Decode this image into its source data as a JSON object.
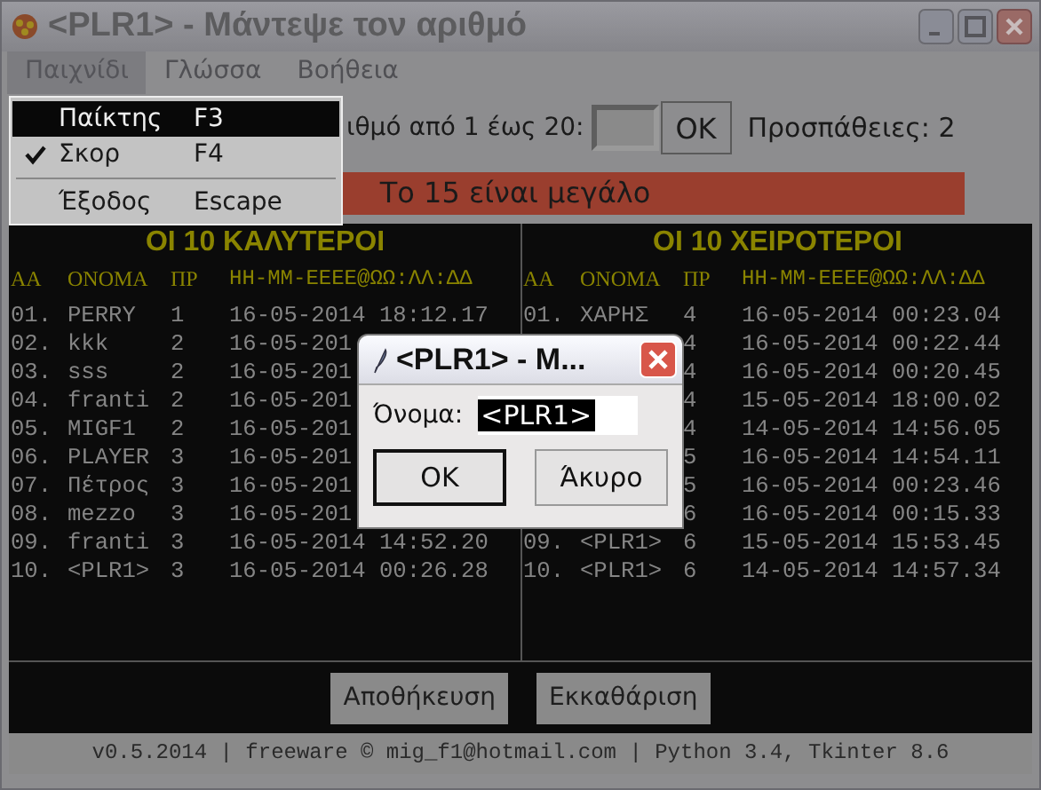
{
  "window": {
    "title": "<PLR1> - Μάντεψε τον αριθμό"
  },
  "menu_bar": [
    {
      "label": "Παιχνίδι",
      "selected": true
    },
    {
      "label": "Γλώσσα",
      "selected": false
    },
    {
      "label": "Βοήθεια",
      "selected": false
    }
  ],
  "menu_dropdown": [
    {
      "kind": "item",
      "label": "Παίκτης",
      "shortcut": "F3",
      "selected": true,
      "checked": false
    },
    {
      "kind": "item",
      "label": "Σκορ",
      "shortcut": "F4",
      "selected": false,
      "checked": true
    },
    {
      "kind": "separator"
    },
    {
      "kind": "item",
      "label": "Έξοδος",
      "shortcut": "Escape",
      "selected": false,
      "checked": false
    }
  ],
  "guess": {
    "prompt": "ιθμό από 1 έως 20:",
    "ok_button": "OK",
    "attempts": "Προσπάθειες: 2"
  },
  "message": "Το 15 είναι μεγάλο",
  "scoreboards": [
    {
      "title": "ΟΙ 10 ΚΑΛΥΤΕΡΟΙ",
      "columns": [
        "ΑΑ",
        "ΟΝΟΜΑ",
        "ΠΡ",
        "ΗΗ-ΜΜ-ΕΕΕΕ@ΩΩ:ΛΛ:ΔΔ"
      ],
      "rows": [
        {
          "rank": "01.",
          "name": "PERRY",
          "tries": "1",
          "date": "16-05-2014 18:12.17"
        },
        {
          "rank": "02.",
          "name": "kkk",
          "tries": "2",
          "date": "16-05-201"
        },
        {
          "rank": "03.",
          "name": "sss",
          "tries": "2",
          "date": "16-05-201"
        },
        {
          "rank": "04.",
          "name": "franti",
          "tries": "2",
          "date": "16-05-201"
        },
        {
          "rank": "05.",
          "name": "MIGF1",
          "tries": "2",
          "date": "16-05-201"
        },
        {
          "rank": "06.",
          "name": "PLAYER",
          "tries": "3",
          "date": "16-05-201"
        },
        {
          "rank": "07.",
          "name": "Πέτρος",
          "tries": "3",
          "date": "16-05-201"
        },
        {
          "rank": "08.",
          "name": "mezzo",
          "tries": "3",
          "date": "16-05-201"
        },
        {
          "rank": "09.",
          "name": "franti",
          "tries": "3",
          "date": "16-05-2014 14:52.20"
        },
        {
          "rank": "10.",
          "name": "<PLR1>",
          "tries": "3",
          "date": "16-05-2014 00:26.28"
        }
      ]
    },
    {
      "title": "ΟΙ 10 ΧΕΙΡΟΤΕΡΟΙ",
      "columns": [
        "ΑΑ",
        "ΟΝΟΜΑ",
        "ΠΡ",
        "ΗΗ-ΜΜ-ΕΕΕΕ@ΩΩ:ΛΛ:ΔΔ"
      ],
      "rows": [
        {
          "rank": "01.",
          "name": "ΧΑΡΗΣ",
          "tries": "4",
          "date": "16-05-2014 00:23.04"
        },
        {
          "tries": "4",
          "date": "16-05-2014 00:22.44"
        },
        {
          "tries": "4",
          "date": "16-05-2014 00:20.45"
        },
        {
          "tries": "4",
          "date": "15-05-2014 18:00.02"
        },
        {
          "tries": "4",
          "date": "14-05-2014 14:56.05"
        },
        {
          "tries": "5",
          "date": "16-05-2014 14:54.11"
        },
        {
          "tries": "5",
          "date": "16-05-2014 00:23.46"
        },
        {
          "tries": "6",
          "date": "16-05-2014 00:15.33"
        },
        {
          "rank": "09.",
          "name": "<PLR1>",
          "tries": "6",
          "date": "15-05-2014 15:53.45"
        },
        {
          "rank": "10.",
          "name": "<PLR1>",
          "tries": "6",
          "date": "14-05-2014 14:57.34"
        }
      ]
    }
  ],
  "buttons": [
    "Αποθήκευση",
    "Εκκαθάριση"
  ],
  "status_bar": "v0.5.2014 | freeware © mig_f1@hotmail.com | Python 3.4, Tkinter 8.6",
  "dialog": {
    "title": "<PLR1> - Μ...",
    "label": "Όνομα:",
    "value": "<PLR1>",
    "buttons": [
      {
        "label": "OK",
        "default": true
      },
      {
        "label": "Άκυρο",
        "default": false
      }
    ]
  }
}
